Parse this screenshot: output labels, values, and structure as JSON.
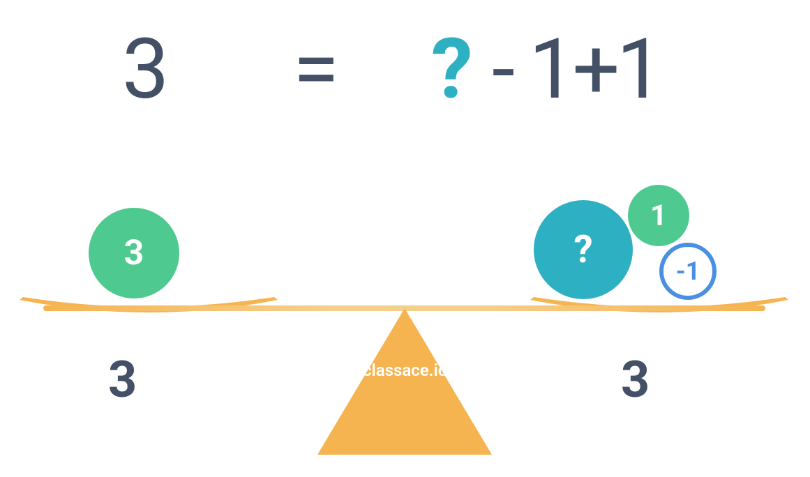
{
  "equation": {
    "left": "3",
    "equals": "=",
    "unknown": "?",
    "rest": "- 1+1"
  },
  "balance": {
    "left_pan": {
      "ball_value": "3",
      "weight_label": "3"
    },
    "right_pan": {
      "ball_unknown": "?",
      "ball_plus": "1",
      "ball_minus": "-1",
      "weight_label": "3"
    }
  },
  "watermark": "classace.io",
  "colors": {
    "text_dark": "#435066",
    "teal": "#2db1c2",
    "green": "#4ec98f",
    "blue": "#4a90e2",
    "orange": "#f5b450",
    "orange_light": "#f5cf8c"
  }
}
